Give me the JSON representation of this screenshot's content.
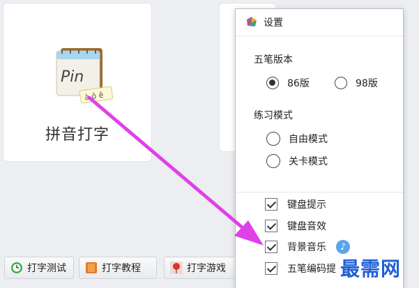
{
  "card": {
    "label": "拼音打字",
    "icon": "pin-notebook-icon",
    "icon_text": "Pin",
    "icon_tag": "à ō ê"
  },
  "toolbar": [
    {
      "label": "打字测试",
      "icon": "clock-icon"
    },
    {
      "label": "打字教程",
      "icon": "book-icon"
    },
    {
      "label": "打字游戏",
      "icon": "balloon-icon"
    }
  ],
  "settings": {
    "title": "设置",
    "wubi_version": {
      "label": "五笔版本",
      "options": [
        {
          "label": "86版",
          "selected": true
        },
        {
          "label": "98版",
          "selected": false
        }
      ]
    },
    "practice_mode": {
      "label": "练习模式",
      "options": [
        {
          "label": "自由模式",
          "selected": false
        },
        {
          "label": "关卡模式",
          "selected": false
        }
      ]
    },
    "checks": [
      {
        "label": "键盘提示",
        "checked": true
      },
      {
        "label": "键盘音效",
        "checked": true
      },
      {
        "label": "背景音乐",
        "checked": true
      },
      {
        "label": "五笔编码提",
        "checked": true
      }
    ]
  },
  "watermark": "最需网",
  "colors": {
    "accent_arrow": "#e040e8",
    "watermark": "#1f5fd6",
    "music_icon": "#5aa4ee"
  }
}
